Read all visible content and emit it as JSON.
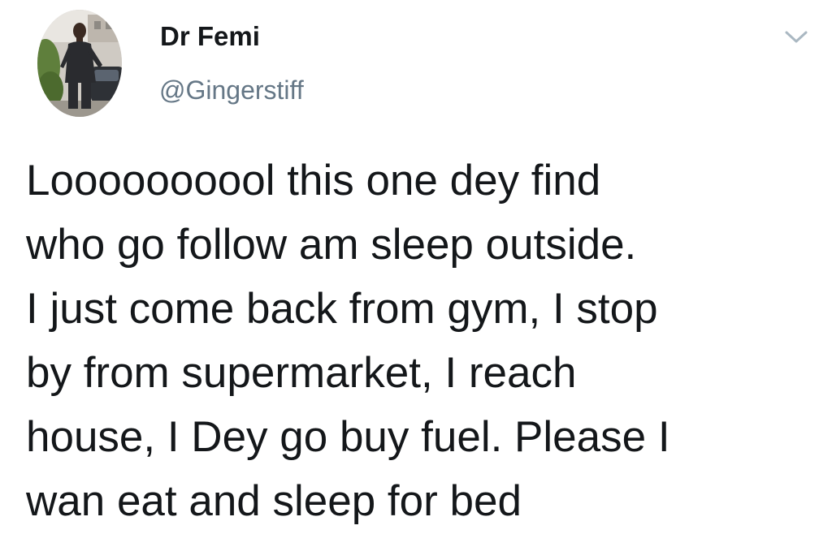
{
  "author": {
    "display_name": "Dr Femi",
    "handle": "@Gingerstiff",
    "avatar_icon": "profile-photo"
  },
  "menu": {
    "icon": "chevron-down-icon",
    "icon_color": "#aab8c2"
  },
  "tweet": {
    "lines": [
      "Loooooooool this one dey find",
      "who go follow am sleep outside.",
      "I just come back from gym, I stop",
      "by from supermarket, I reach",
      "house, I Dey go buy fuel. Please I",
      "wan eat and sleep for bed"
    ]
  },
  "colors": {
    "text": "#14171a",
    "secondary": "#657786",
    "background": "#ffffff"
  }
}
